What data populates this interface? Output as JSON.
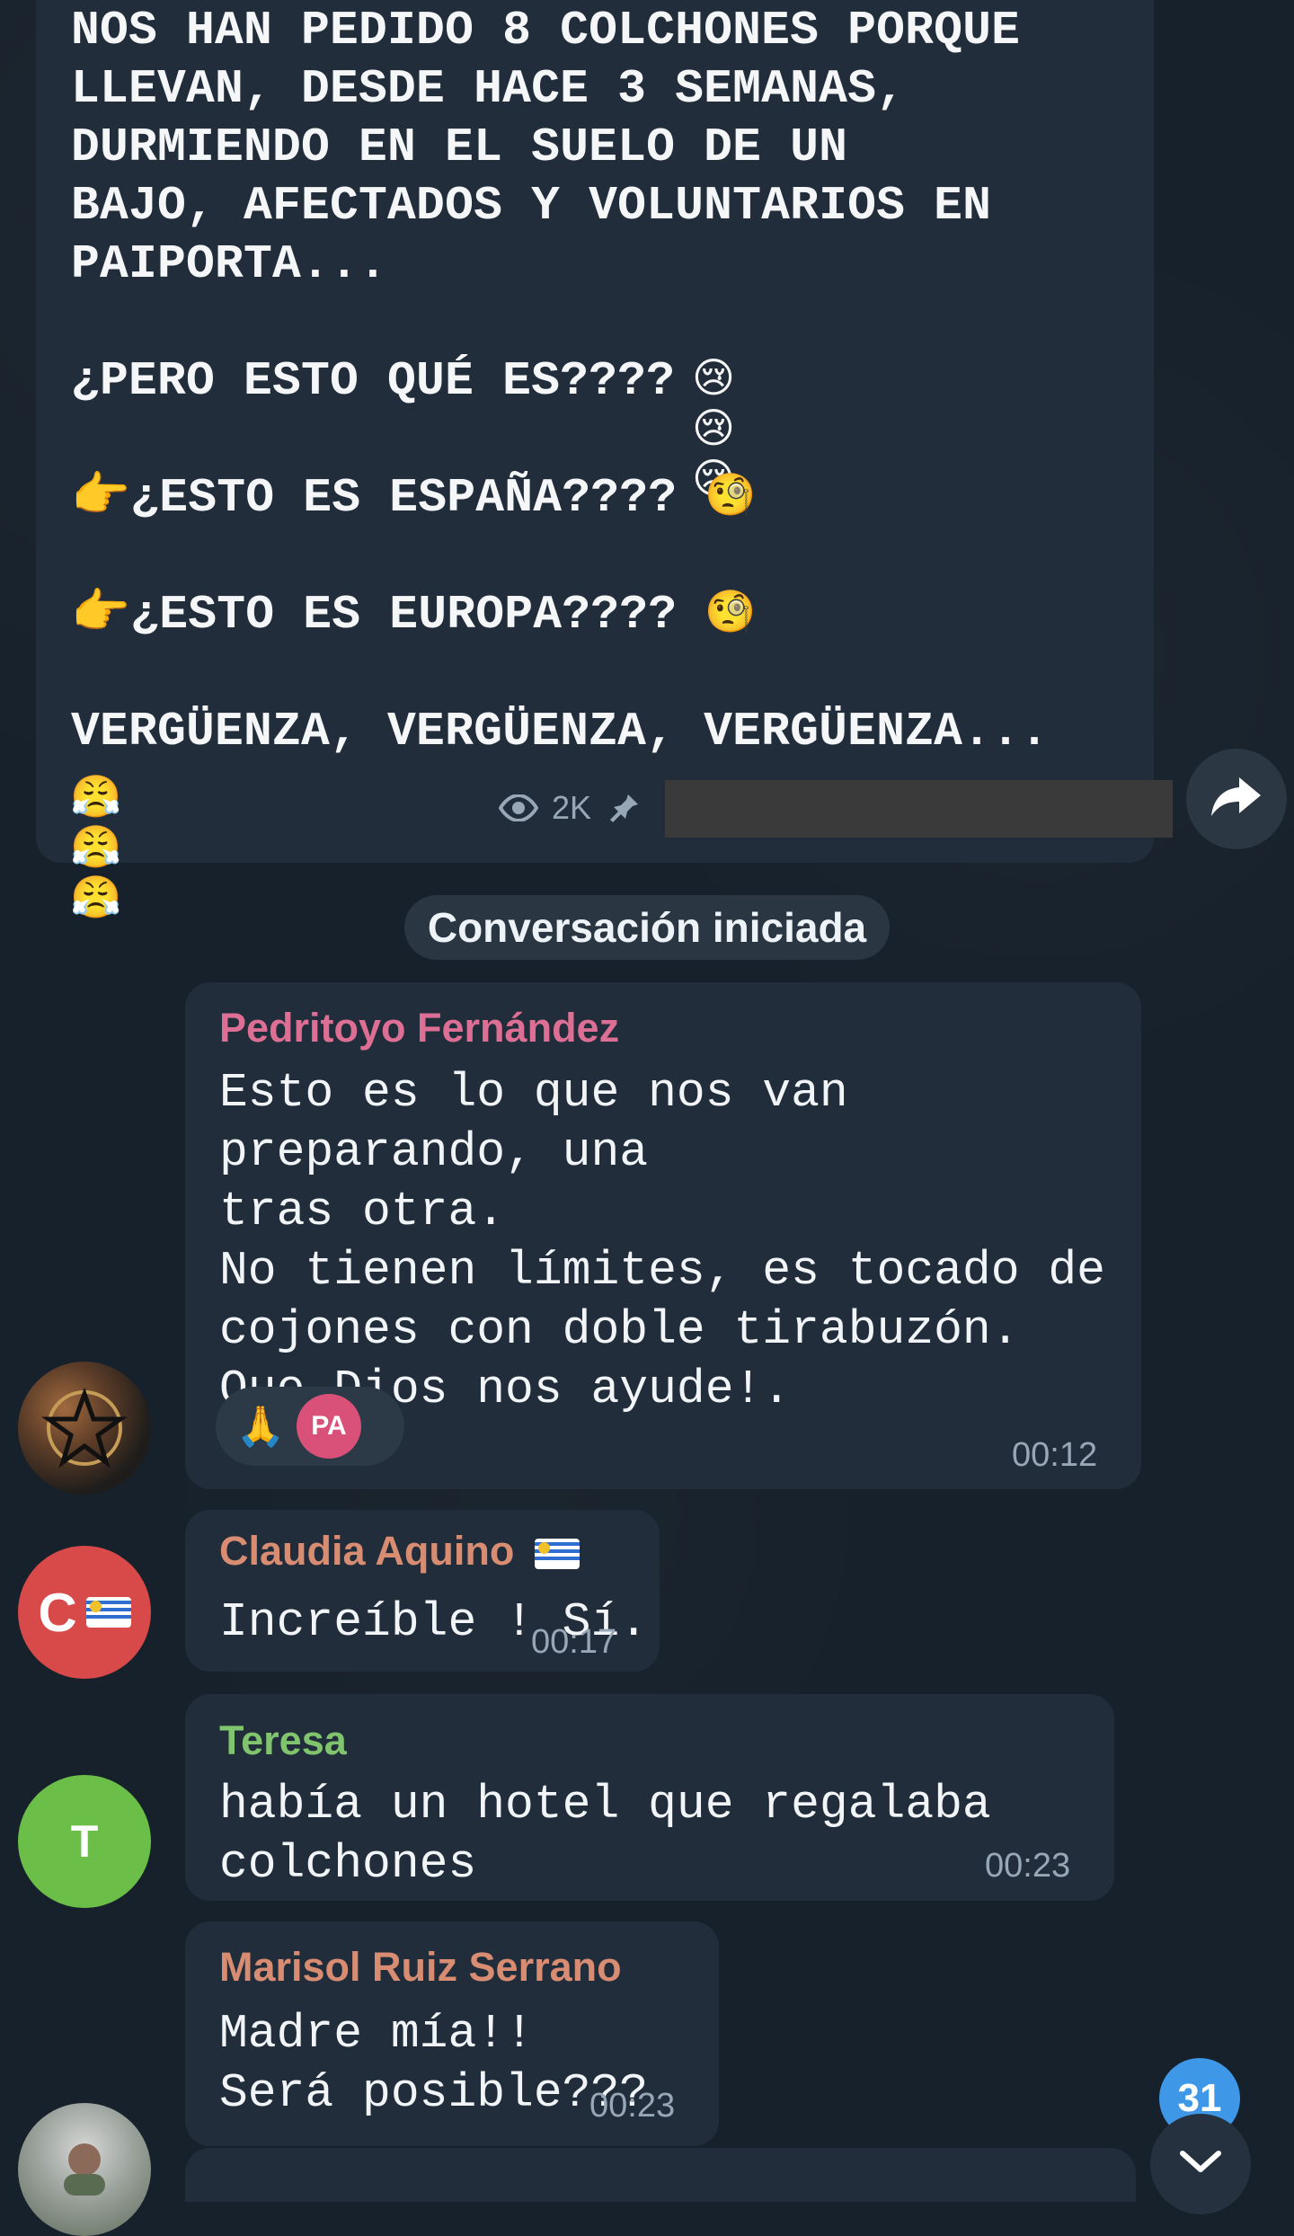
{
  "channel_post": {
    "text": "NOS HAN PEDIDO 8 COLCHONES PORQUE\nLLEVAN, DESDE HACE 3 SEMANAS,\nDURMIENDO EN EL SUELO DE UN\nBAJO, AFECTADOS Y VOLUNTARIOS EN\nPAIPORTA...\n\n¿PERO ESTO QUÉ ES????\n\n👉¿ESTO ES ESPAÑA????\n\n👉¿ESTO ES EUROPA????\n\nVERGÜENZA, VERGÜENZA, VERGÜENZA...",
    "emoji_row_1": "😢😢😢",
    "emoji_row_2": "🧐",
    "emoji_row_3": "🧐",
    "emoji_row_4": "😤😤😤",
    "views": "2K"
  },
  "icons": {
    "views": "eye-icon",
    "pin": "pin-icon",
    "forward": "forward-arrow-icon",
    "scroll": "chevron-down-icon"
  },
  "date_chip": {
    "label": "Conversación iniciada"
  },
  "messages": [
    {
      "sender": "Pedritoyo Fernández",
      "text": "Esto es lo que nos van preparando, una\ntras otra.\nNo tienen límites, es tocado de\ncojones con doble tirabuzón.\nQue Dios nos ayude!.",
      "time": "00:12",
      "reaction": {
        "emoji": "🙏",
        "user_initials": "PA"
      }
    },
    {
      "sender": "Claudia Aquino",
      "text": "Increíble ! Sí.",
      "time": "00:17",
      "avatar_initial": "C"
    },
    {
      "sender": "Teresa",
      "text": "había un hotel que regalaba colchones",
      "time": "00:23",
      "avatar_initial": "T"
    },
    {
      "sender": "Marisol Ruiz Serrano",
      "text": "Madre mía!!\nSerá posible???",
      "time": "00:23"
    }
  ],
  "unread_count": "31",
  "colors": {
    "background": "#17212b",
    "bubble": "#212d3b",
    "meta_text": "#98a7b6",
    "sender_pink": "#dc6f93",
    "sender_orange": "#d88c72",
    "sender_green": "#80c56e",
    "badge_blue": "#3e98e7"
  }
}
